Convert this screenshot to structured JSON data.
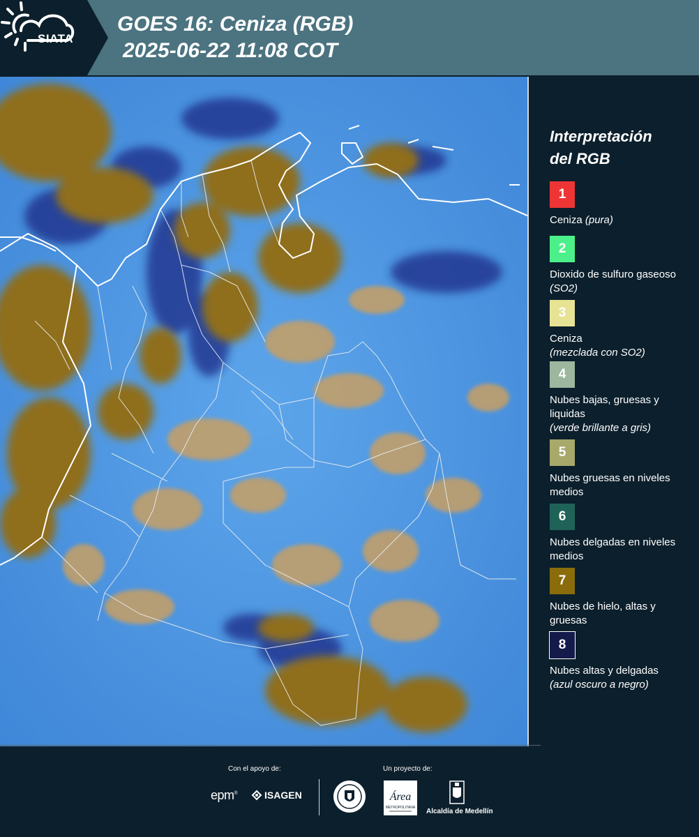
{
  "header": {
    "logo_text": "SIATA",
    "title": "GOES 16: Ceniza (RGB)",
    "subtitle": "2025-06-22 11:08 COT"
  },
  "legend": {
    "title_line1": "Interpretación",
    "title_line2": "del RGB",
    "items": [
      {
        "number": "1",
        "color": "#ee3535",
        "text_color": "#ffffff",
        "label": "Ceniza",
        "note": "(pura)",
        "note_inline": true
      },
      {
        "number": "2",
        "color": "#4cf08a",
        "text_color": "#ffffff",
        "label": "Dioxido de sulfuro gaseoso",
        "note": "(SO2)",
        "note_inline": true
      },
      {
        "number": "3",
        "color": "#e6e394",
        "text_color": "#ffffff",
        "label": "Ceniza",
        "note": "(mezclada con SO2)",
        "note_inline": false
      },
      {
        "number": "4",
        "color": "#9cb79e",
        "text_color": "#ffffff",
        "label": "Nubes bajas, gruesas y liquidas",
        "note": "(verde brillante a gris)",
        "note_inline": false
      },
      {
        "number": "5",
        "color": "#a8a86a",
        "text_color": "#ffffff",
        "label": "Nubes gruesas en niveles medios",
        "note": "",
        "note_inline": false
      },
      {
        "number": "6",
        "color": "#1f6358",
        "text_color": "#ffffff",
        "label": "Nubes delgadas en niveles medios",
        "note": "",
        "note_inline": false
      },
      {
        "number": "7",
        "color": "#8a6c0a",
        "text_color": "#ffffff",
        "label": "Nubes de hielo, altas y gruesas",
        "note": "",
        "note_inline": false
      },
      {
        "number": "8",
        "color": "#141a4a",
        "text_color": "#ffffff",
        "label": "Nubes altas y delgadas",
        "note": "(azul oscuro a negro)",
        "note_inline": false
      }
    ]
  },
  "footer": {
    "support_label": "Con el apoyo de:",
    "project_label": "Un proyecto de:",
    "sponsor_epm": "epm",
    "sponsor_isagen": "ISAGEN",
    "area_logo_text": "Área",
    "area_logo_sub": "METROPOLITANA",
    "alcaldia_text": "Alcaldía de Medellín"
  },
  "colors": {
    "header_bg": "#4b7380",
    "logo_band": "#0c1f2c",
    "page_bg": "#0c1f2c",
    "ocean_blue": "#4d97e6",
    "ice_cloud": "#8a6c1a",
    "thin_cloud": "#1b2b86"
  }
}
